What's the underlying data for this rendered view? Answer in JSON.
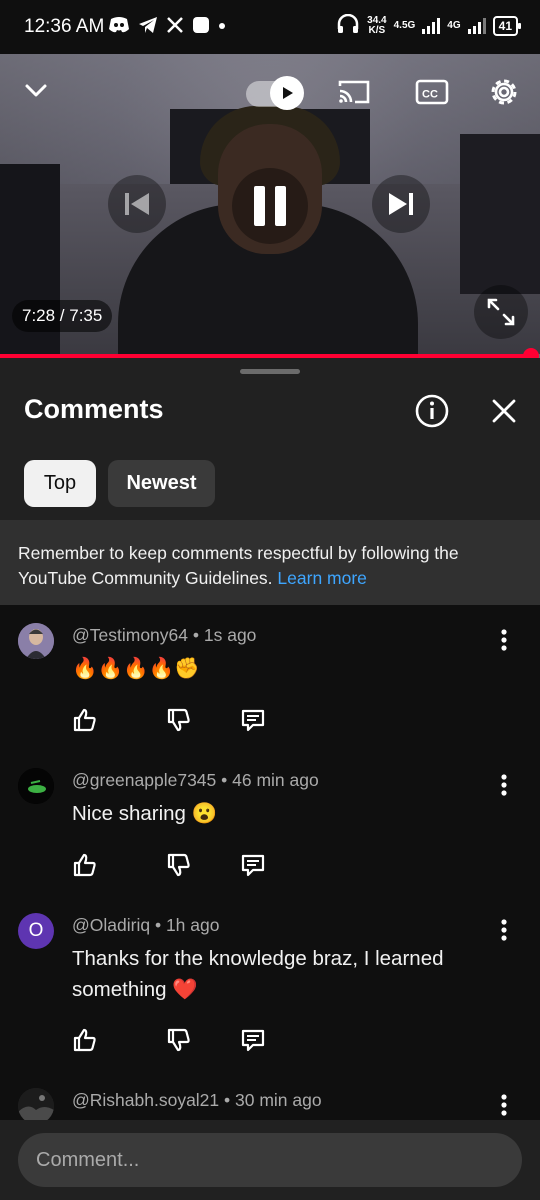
{
  "status_bar": {
    "time": "12:36 AM",
    "speed_value": "34.4",
    "speed_unit": "K/S",
    "net1": "4.5G",
    "net2": "4G",
    "battery": "41"
  },
  "video": {
    "time_label": "7:28 / 7:35",
    "progress_fraction": 0.983,
    "icons": [
      "chevron-down-icon",
      "autoplay-toggle",
      "cast-icon",
      "captions-icon",
      "settings-icon",
      "previous-icon",
      "pause-icon",
      "next-icon",
      "fullscreen-icon"
    ]
  },
  "comments_panel": {
    "title": "Comments",
    "chips": [
      "Top",
      "Newest"
    ],
    "notice_text": "Remember to keep comments respectful by following the YouTube Community Guidelines.",
    "notice_link": "Learn more",
    "input_placeholder": "Comment..."
  },
  "comments": [
    {
      "author": "@Testimony64",
      "time": "1s ago",
      "text": "🔥🔥🔥🔥✊",
      "avatar_color": "#7b6aa0"
    },
    {
      "author": "@greenapple7345",
      "time": "46 min ago",
      "text": "Nice sharing 😮",
      "avatar_color": "#000000"
    },
    {
      "author": "@Oladiriq",
      "time": "1h ago",
      "text": "Thanks for the knowledge braz, I learned something ❤️",
      "avatar_color": "#5e35b1",
      "avatar_letter": "O"
    },
    {
      "author": "@Rishabh.soyal21",
      "time": "30 min ago",
      "text": "",
      "avatar_color": "#2a2a2a"
    }
  ]
}
